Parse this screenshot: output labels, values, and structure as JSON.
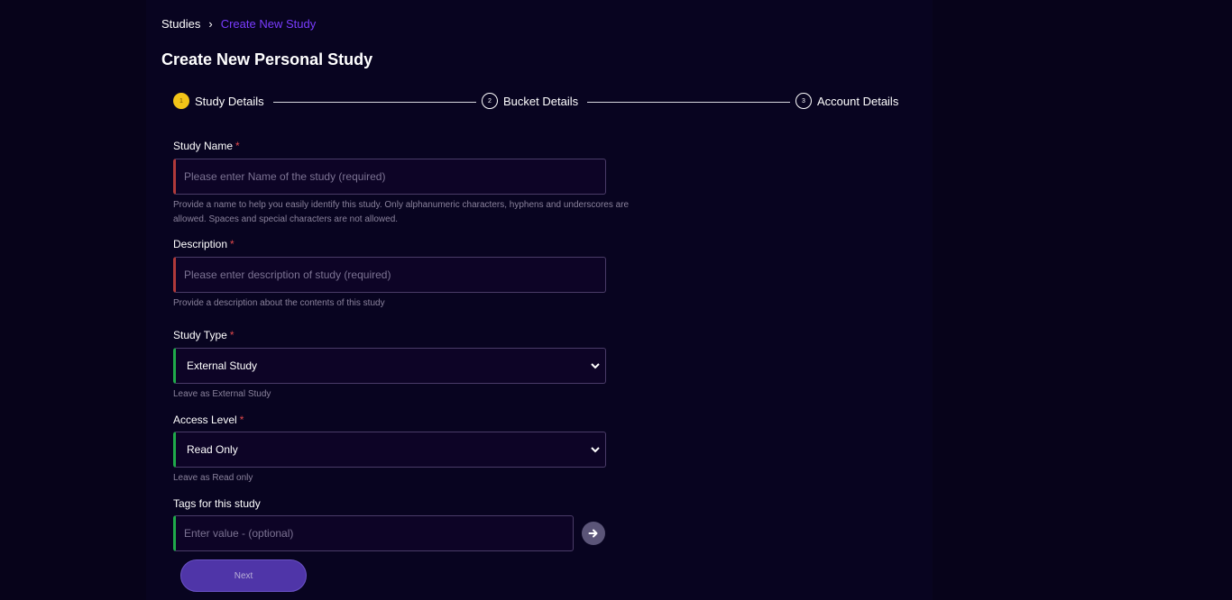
{
  "breadcrumb": {
    "root": "Studies",
    "separator": "›",
    "current": "Create New Study"
  },
  "page": {
    "title": "Create New Personal Study"
  },
  "stepper": {
    "steps": [
      {
        "number": "1",
        "label": "Study Details",
        "active": true
      },
      {
        "number": "2",
        "label": "Bucket Details",
        "active": false
      },
      {
        "number": "3",
        "label": "Account Details",
        "active": false
      }
    ]
  },
  "form": {
    "required_mark": "*",
    "study_name": {
      "label": "Study Name",
      "placeholder": "Please enter Name of the study (required)",
      "value": "",
      "help_line1": "Provide a name to help you easily identify this study. Only alphanumeric characters, hyphens and underscores are",
      "help_line2": "allowed. Spaces and special characters are not allowed."
    },
    "description": {
      "label": "Description",
      "placeholder": "Please enter description of study (required)",
      "value": "",
      "help": "Provide a description about the contents of this study"
    },
    "study_type": {
      "label": "Study Type",
      "selected": "External Study",
      "help": "Leave as External Study"
    },
    "access_level": {
      "label": "Access Level",
      "selected": "Read Only",
      "help": "Leave as Read only"
    },
    "tags": {
      "label": "Tags for this study",
      "placeholder": "Enter value - (optional)",
      "value": ""
    },
    "next_label": "Next"
  },
  "icons": {
    "breadcrumb_separator": "chevron-right-icon",
    "select_chevron": "chevron-down-icon",
    "add_tag": "arrow-right-icon"
  },
  "colors": {
    "background": "#07031a",
    "accent_purple": "#7a3cff",
    "active_step": "#f2c418",
    "invalid_border": "#b03a3a",
    "valid_border": "#1faa4a",
    "button": "#4f35a8"
  }
}
